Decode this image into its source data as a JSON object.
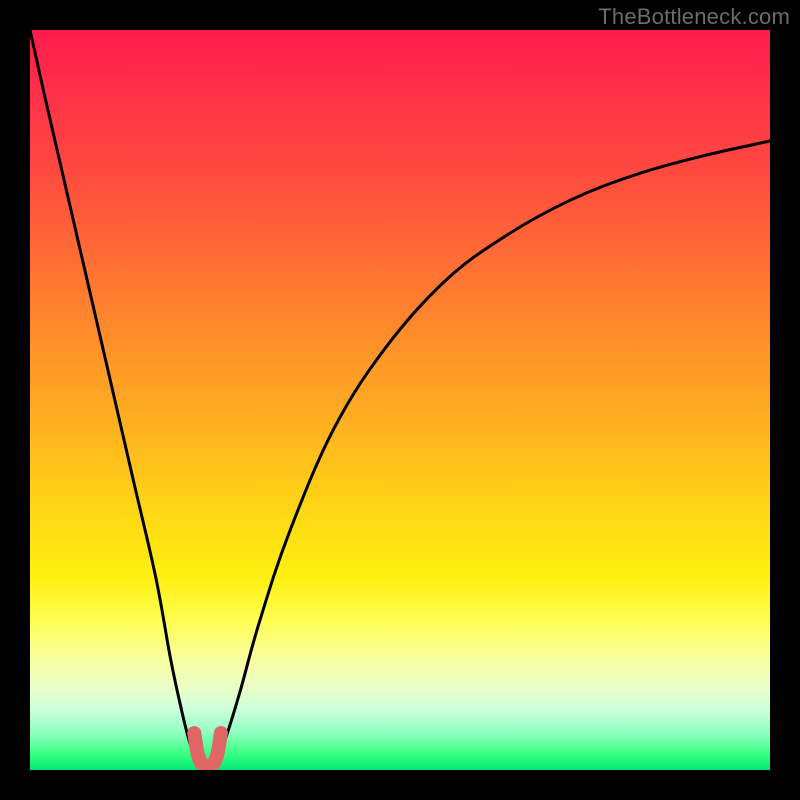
{
  "watermark": {
    "text": "TheBottleneck.com"
  },
  "colors": {
    "background": "#000000",
    "curve": "#000000",
    "highlight": "#e06666"
  },
  "chart_data": {
    "type": "line",
    "title": "",
    "xlabel": "",
    "ylabel": "",
    "xlim": [
      0,
      100
    ],
    "ylim": [
      0,
      100
    ],
    "grid": false,
    "series": [
      {
        "name": "left-branch",
        "x": [
          0,
          2,
          5,
          8,
          11,
          14,
          17,
          19,
          20.5,
          21.5,
          22.2,
          22.8
        ],
        "y": [
          100,
          91,
          78,
          65,
          52,
          39,
          26,
          15,
          8,
          4,
          2,
          1
        ]
      },
      {
        "name": "right-branch",
        "x": [
          25.2,
          26,
          27,
          28.5,
          31,
          35,
          41,
          48,
          56,
          64,
          73,
          82,
          91,
          100
        ],
        "y": [
          1,
          3,
          6,
          11,
          20,
          32,
          46,
          57,
          66,
          72,
          77,
          80.5,
          83,
          85
        ]
      },
      {
        "name": "valley-highlight",
        "x": [
          22.2,
          22.6,
          23.0,
          23.5,
          24.0,
          24.5,
          25.0,
          25.4,
          25.8
        ],
        "y": [
          5,
          2.5,
          1.2,
          0.6,
          0.5,
          0.6,
          1.2,
          2.5,
          5
        ]
      }
    ],
    "annotations": []
  }
}
